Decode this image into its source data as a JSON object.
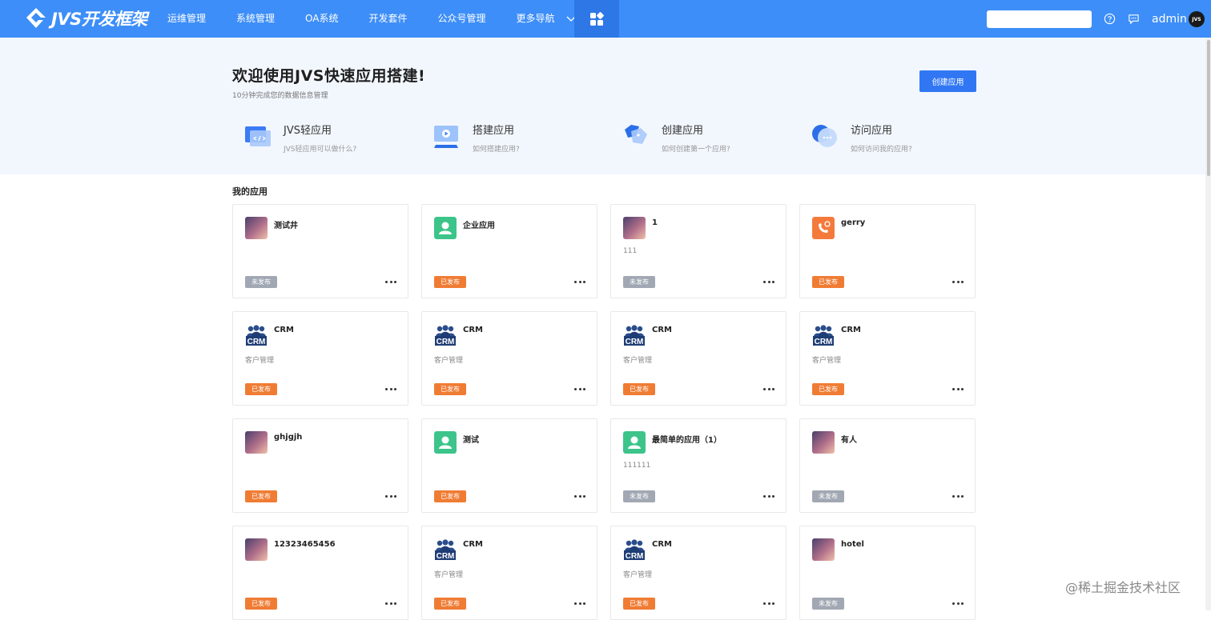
{
  "header": {
    "logo_text": "JVS开发框架",
    "nav": [
      {
        "label": "运维管理"
      },
      {
        "label": "系统管理"
      },
      {
        "label": "OA系统"
      },
      {
        "label": "开发套件"
      },
      {
        "label": "公众号管理"
      },
      {
        "label": "更多导航"
      }
    ],
    "search_value": "",
    "username": "admin",
    "avatar_text": "JVS",
    "accent": "#3d8ef8"
  },
  "hero": {
    "title": "欢迎使用JVS快速应用搭建!",
    "subtitle": "10分钟完成您的数据信息管理",
    "create_label": "创建应用",
    "guides": [
      {
        "title": "JVS轻应用",
        "desc": "JVS轻应用可以做什么?",
        "icon": "monitor-code-icon"
      },
      {
        "title": "搭建应用",
        "desc": "如何搭建应用?",
        "icon": "video-screen-icon"
      },
      {
        "title": "创建应用",
        "desc": "如何创建第一个应用?",
        "icon": "cube-icon"
      },
      {
        "title": "访问应用",
        "desc": "如何访问我的应用?",
        "icon": "chat-bubble-icon"
      }
    ]
  },
  "apps": {
    "section_title": "我的应用",
    "colors": {
      "published": "#f07c34",
      "unpublished": "#a1a8b3"
    },
    "items": [
      {
        "name": "测试井",
        "desc": "",
        "status": "未发布",
        "published": false,
        "icon": "gradient-icon"
      },
      {
        "name": "企业应用",
        "desc": "",
        "status": "已发布",
        "published": true,
        "icon": "user-green-icon"
      },
      {
        "name": "1",
        "desc": "111",
        "status": "未发布",
        "published": false,
        "icon": "gradient-icon"
      },
      {
        "name": "gerry",
        "desc": "",
        "status": "已发布",
        "published": true,
        "icon": "phone-orange-icon"
      },
      {
        "name": "CRM",
        "desc": "客户管理",
        "status": "已发布",
        "published": true,
        "icon": "crm-icon"
      },
      {
        "name": "CRM",
        "desc": "客户管理",
        "status": "已发布",
        "published": true,
        "icon": "crm-icon"
      },
      {
        "name": "CRM",
        "desc": "客户管理",
        "status": "已发布",
        "published": true,
        "icon": "crm-icon"
      },
      {
        "name": "CRM",
        "desc": "客户管理",
        "status": "已发布",
        "published": true,
        "icon": "crm-icon"
      },
      {
        "name": "ghjgjh",
        "desc": "",
        "status": "已发布",
        "published": true,
        "icon": "gradient-icon"
      },
      {
        "name": "测试",
        "desc": "",
        "status": "已发布",
        "published": true,
        "icon": "user-green-icon"
      },
      {
        "name": "最简单的应用（1）",
        "desc": "111111",
        "status": "未发布",
        "published": false,
        "icon": "user-green-icon"
      },
      {
        "name": "有人",
        "desc": "",
        "status": "未发布",
        "published": false,
        "icon": "gradient-icon"
      },
      {
        "name": "12323465456",
        "desc": "",
        "status": "已发布",
        "published": true,
        "icon": "gradient-icon"
      },
      {
        "name": "CRM",
        "desc": "客户管理",
        "status": "已发布",
        "published": true,
        "icon": "crm-icon"
      },
      {
        "name": "CRM",
        "desc": "客户管理",
        "status": "已发布",
        "published": true,
        "icon": "crm-icon"
      },
      {
        "name": "hotel",
        "desc": "",
        "status": "未发布",
        "published": false,
        "icon": "gradient-icon"
      }
    ]
  },
  "watermark": "@稀土掘金技术社区"
}
